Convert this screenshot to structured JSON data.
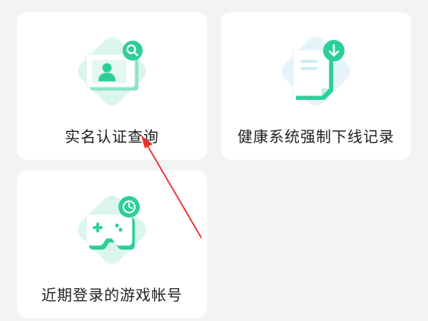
{
  "cards": [
    {
      "label": "实名认证查询",
      "icon": "id-card-search-icon"
    },
    {
      "label": "健康系统强制下线记录",
      "icon": "document-download-icon"
    },
    {
      "label": "近期登录的游戏帐号",
      "icon": "gamepad-clock-icon"
    }
  ],
  "colors": {
    "background": "#f2f3f5",
    "card": "#ffffff",
    "accent_green": "#2ccf99",
    "diamond_green": "#ddf6ec",
    "diamond_blue": "#e5f3fb",
    "annotation_arrow": "#e8322b"
  }
}
